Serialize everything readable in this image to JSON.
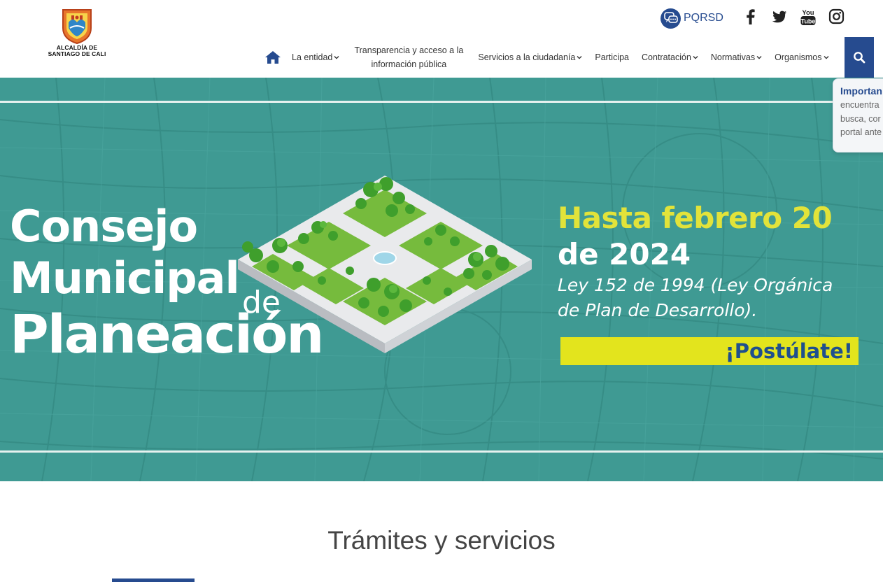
{
  "header": {
    "logo": {
      "line1": "ALCALDÍA DE",
      "line2": "SANTIAGO DE CALI"
    },
    "pqrsd_label": "PQRSD",
    "social": [
      "facebook-icon",
      "twitter-icon",
      "youtube-icon",
      "instagram-icon"
    ],
    "youtube_text": {
      "top": "You",
      "bottom": "Tube"
    }
  },
  "nav": {
    "home_icon": "home-icon",
    "items": [
      {
        "label": "La entidad",
        "dropdown": true
      },
      {
        "label": "Transparencia y acceso a la información pública",
        "dropdown": false
      },
      {
        "label": "Servicios a la ciudadanía",
        "dropdown": true
      },
      {
        "label": "Participa",
        "dropdown": false
      },
      {
        "label": "Contratación",
        "dropdown": true
      },
      {
        "label": "Normativas",
        "dropdown": true
      },
      {
        "label": "Organismos",
        "dropdown": true
      }
    ],
    "search_icon": "search-icon"
  },
  "banner": {
    "title_line1": "Consejo",
    "title_line2": "Municipal",
    "title_de": "de",
    "title_line3": "Planeación",
    "deadline_line1": "Hasta febrero 20",
    "deadline_line2": "de 2024",
    "law_line1": "Ley 152 de 1994 (Ley Orgánica",
    "law_line2": "de Plan de Desarrollo).",
    "cta_label": "¡Postúlate!",
    "colors": {
      "background": "#3f9a93",
      "accent_yellow": "#e2e33a",
      "cta_text": "#1f4f8e"
    }
  },
  "notice": {
    "title": "Importan",
    "lines": [
      "encuentra",
      "busca, cor",
      "portal ante"
    ]
  },
  "tramites": {
    "title": "Trámites y servicios"
  },
  "colors": {
    "brand_blue": "#264b8f"
  }
}
